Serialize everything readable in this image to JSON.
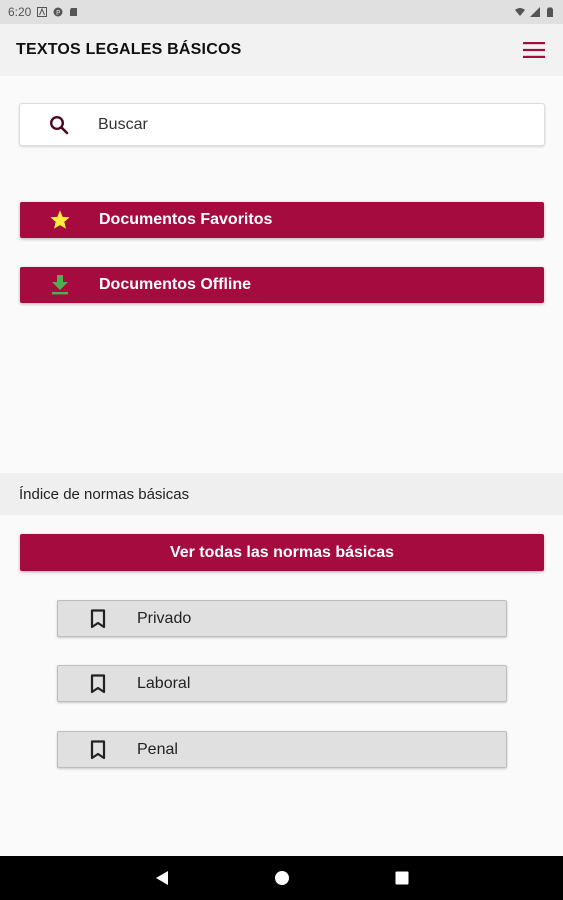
{
  "status_bar": {
    "time": "6:20",
    "icons": [
      "a-icon",
      "p-icon",
      "sd-card-icon",
      "wifi-icon",
      "signal-icon",
      "battery-icon"
    ]
  },
  "app_bar": {
    "title": "TEXTOS LEGALES BÁSICOS",
    "menu_icon": "hamburger-menu-icon"
  },
  "search": {
    "placeholder": "Buscar",
    "icon": "search-icon"
  },
  "main_buttons": [
    {
      "label": "Documentos Favoritos",
      "icon": "star-icon"
    },
    {
      "label": "Documentos Offline",
      "icon": "download-icon"
    }
  ],
  "index_section": {
    "title": "Índice de normas básicas",
    "all_button": "Ver todas las normas básicas"
  },
  "categories": [
    {
      "label": "Privado",
      "icon": "bookmark-icon"
    },
    {
      "label": "Laboral",
      "icon": "bookmark-icon"
    },
    {
      "label": "Penal",
      "icon": "bookmark-icon"
    }
  ],
  "colors": {
    "accent": "#a50b3e",
    "star": "#ffeb3b",
    "download": "#4caf50"
  },
  "nav_bar": {
    "icons": [
      "back-icon",
      "home-icon",
      "recents-icon"
    ]
  }
}
